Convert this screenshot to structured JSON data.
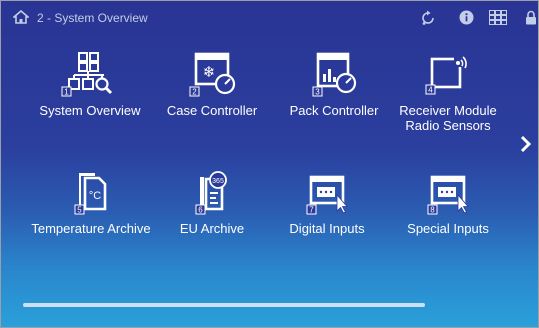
{
  "header": {
    "breadcrumb": "2 - System Overview",
    "icons": [
      "home-icon",
      "refresh-icon",
      "info-icon",
      "grid-icon",
      "lock-icon"
    ]
  },
  "tiles": [
    {
      "number": "1",
      "label": "System Overview",
      "icon": "network-icon"
    },
    {
      "number": "2",
      "label": "Case Controller",
      "icon": "case-controller-icon"
    },
    {
      "number": "3",
      "label": "Pack Controller",
      "icon": "pack-controller-icon"
    },
    {
      "number": "4",
      "label": "Receiver Module\nRadio Sensors",
      "icon": "radio-receiver-icon"
    },
    {
      "number": "5",
      "label": "Temperature Archive",
      "icon": "temperature-archive-icon"
    },
    {
      "number": "6",
      "label": "EU Archive",
      "icon": "eu-archive-icon"
    },
    {
      "number": "7",
      "label": "Digital Inputs",
      "icon": "digital-inputs-icon"
    },
    {
      "number": "8",
      "label": "Special Inputs",
      "icon": "special-inputs-icon"
    }
  ],
  "colors": {
    "text": "#ffffff",
    "breadcrumb": "#c4cde8",
    "background_top": "#2a3494",
    "background_bottom": "#2aa0da"
  }
}
